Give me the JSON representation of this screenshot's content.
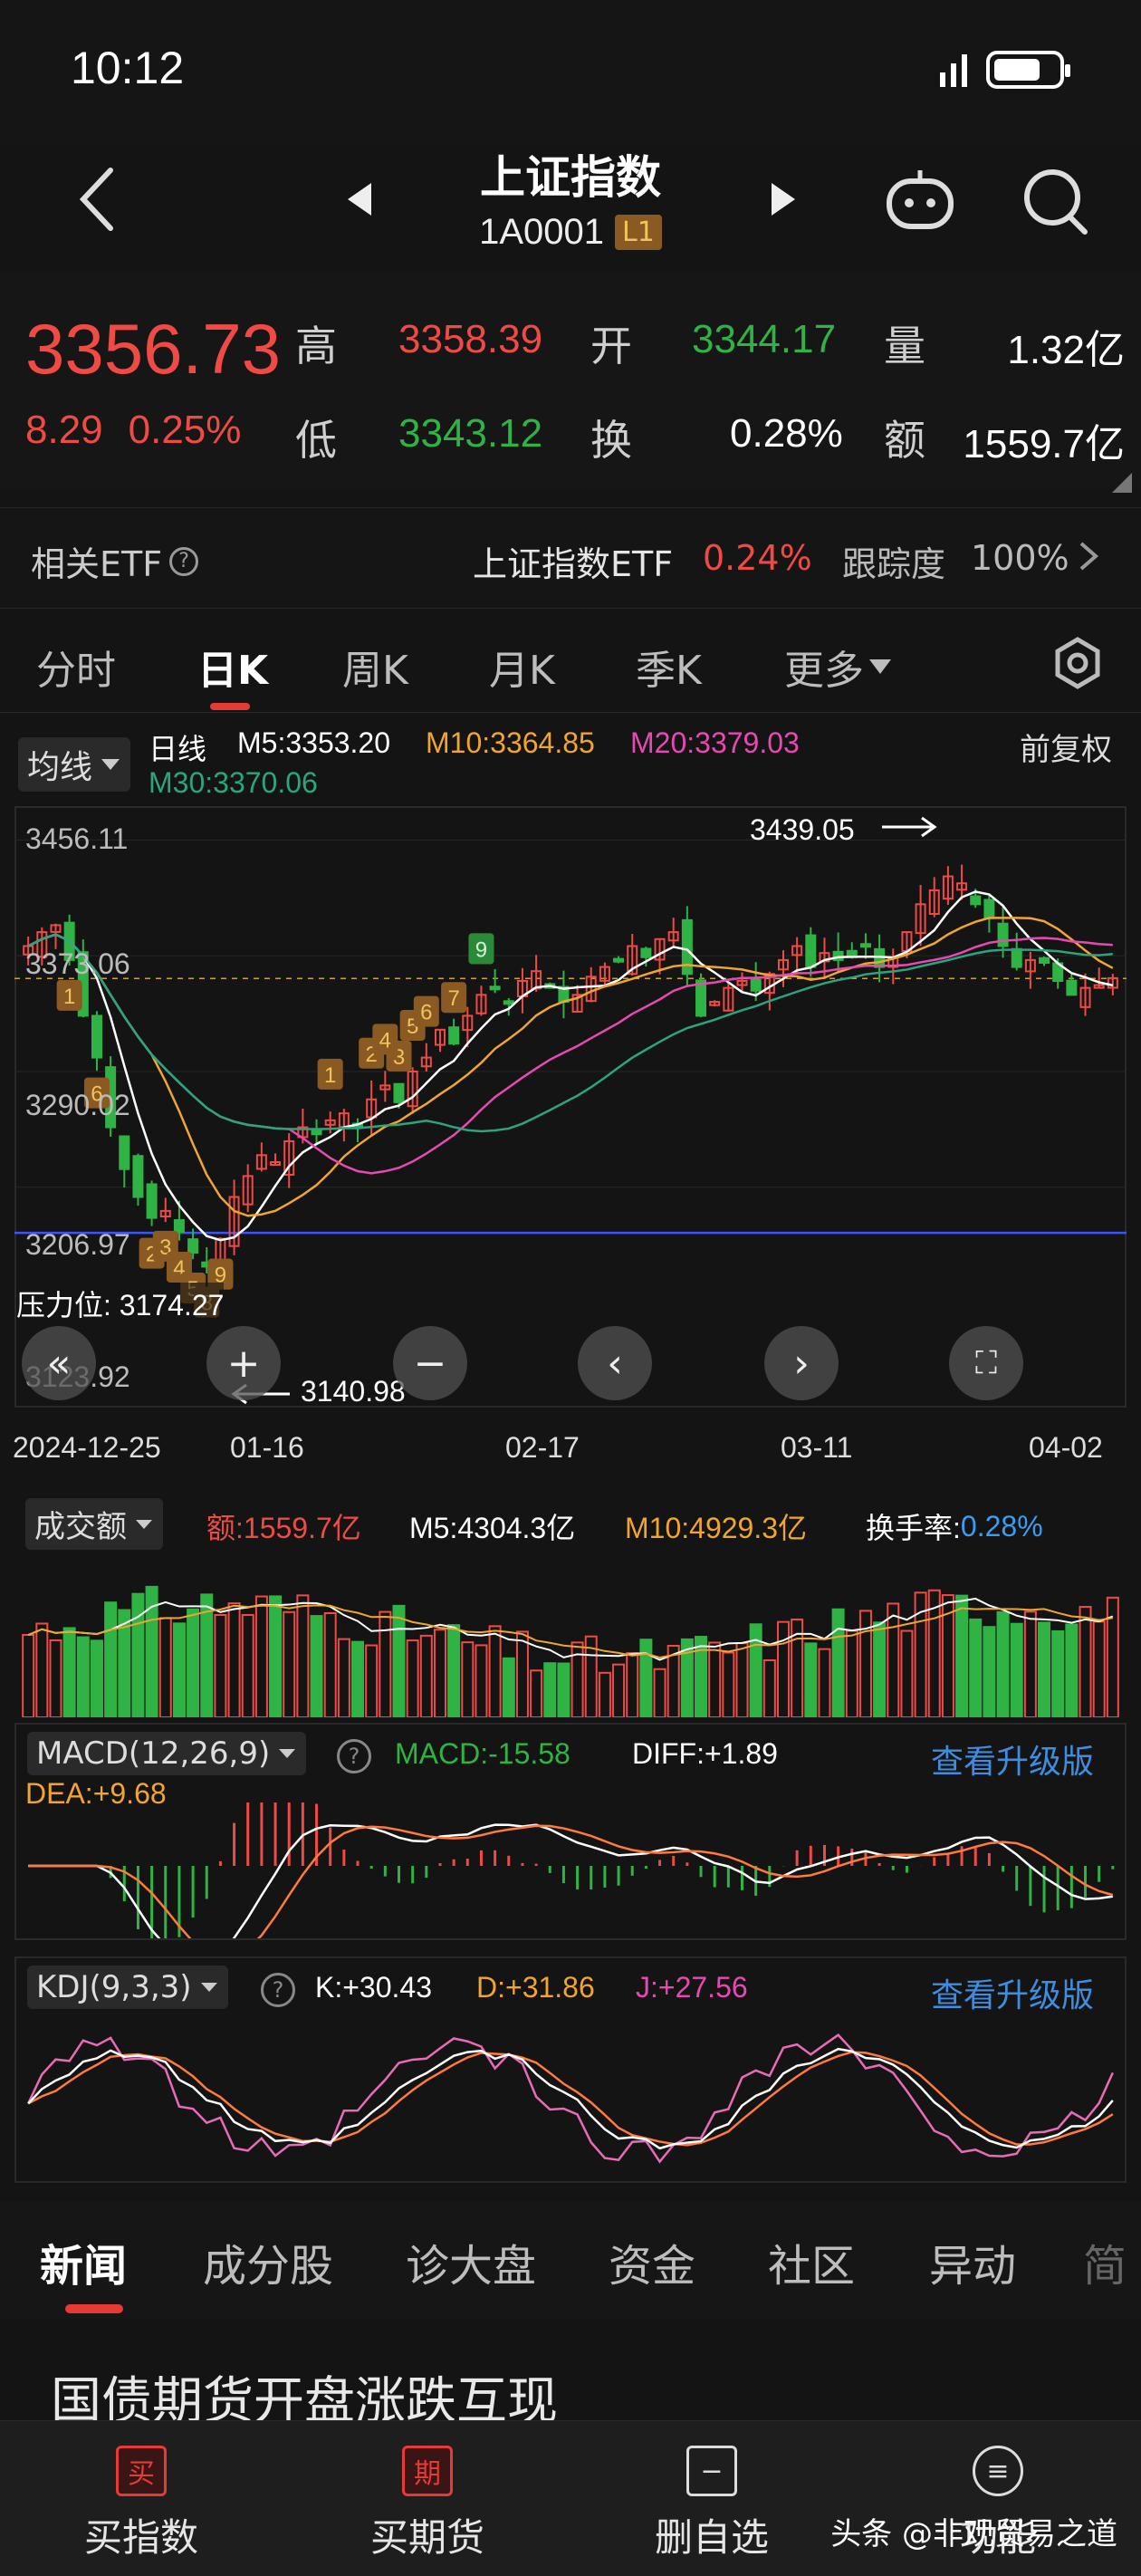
{
  "status": {
    "time": "10:12"
  },
  "header": {
    "title": "上证指数",
    "code": "1A0001",
    "level": "L1"
  },
  "quote": {
    "price": "3356.73",
    "change": "8.29",
    "change_pct": "0.25%",
    "high_label": "高",
    "high": "3358.39",
    "open_label": "开",
    "open": "3344.17",
    "volume_label": "量",
    "volume": "1.32亿",
    "low_label": "低",
    "low": "3343.12",
    "turnover_label": "换",
    "turnover": "0.28%",
    "amount_label": "额",
    "amount": "1559.7亿"
  },
  "etf": {
    "label": "相关ETF",
    "name": "上证指数ETF",
    "pct": "0.24%",
    "track_label": "跟踪度",
    "track": "100%"
  },
  "kline_tabs": {
    "items": [
      {
        "label": "分时"
      },
      {
        "label": "日K"
      },
      {
        "label": "周K"
      },
      {
        "label": "月K"
      },
      {
        "label": "季K"
      },
      {
        "label": "更多"
      }
    ],
    "active": "日K"
  },
  "main_chart": {
    "ma_dropdown": "均线",
    "period_label": "日线",
    "m5": "M5:3353.20",
    "m10": "M10:3364.85",
    "m20": "M20:3379.03",
    "m30": "M30:3370.06",
    "adjust": "前复权",
    "y_ticks": [
      "3456.11",
      "3373.06",
      "3290.02",
      "3206.97",
      "3123.92"
    ],
    "x_ticks": [
      "2024-12-25",
      "01-16",
      "02-17",
      "03-11",
      "04-02"
    ],
    "high_mark": "3439.05",
    "low_mark": "3140.98",
    "pressure": "压力位: 3174.27",
    "seq_labels": [
      "1",
      "2",
      "3",
      "4",
      "5",
      "6",
      "7",
      "8",
      "9",
      "1",
      "2",
      "3",
      "4",
      "5",
      "6",
      "7",
      "8",
      "9"
    ]
  },
  "volume_panel": {
    "dropdown": "成交额",
    "amount": "额:1559.7亿",
    "m5": "M5:4304.3亿",
    "m10": "M10:4929.3亿",
    "turnover_label": "换手率:",
    "turnover": "0.28%"
  },
  "macd_panel": {
    "dropdown": "MACD(12,26,9)",
    "macd": "MACD:-15.58",
    "diff": "DIFF:+1.89",
    "dea": "DEA:+9.68",
    "upgrade": "查看升级版"
  },
  "kdj_panel": {
    "dropdown": "KDJ(9,3,3)",
    "k": "K:+30.43",
    "d": "D:+31.86",
    "j": "J:+27.56",
    "upgrade": "查看升级版"
  },
  "news_tabs": {
    "items": [
      {
        "label": "新闻"
      },
      {
        "label": "成分股"
      },
      {
        "label": "诊大盘"
      },
      {
        "label": "资金"
      },
      {
        "label": "社区"
      },
      {
        "label": "异动"
      },
      {
        "label": "简"
      }
    ],
    "active": "新闻"
  },
  "news": {
    "headline": "国债期货开盘涨跌互现"
  },
  "bottom_nav": {
    "items": [
      {
        "icon": "买",
        "label": "买指数"
      },
      {
        "icon": "期",
        "label": "买期货"
      },
      {
        "icon": "−",
        "label": "删自选"
      },
      {
        "icon": "≡",
        "label": "功能"
      }
    ]
  },
  "watermark": "头条 @非观贸易之道",
  "colors": {
    "up": "#f04a45",
    "down": "#2fb344",
    "m5": "#ffffff",
    "m10": "#f0a530",
    "m20": "#e64ab2",
    "m30": "#2aa57e"
  }
}
